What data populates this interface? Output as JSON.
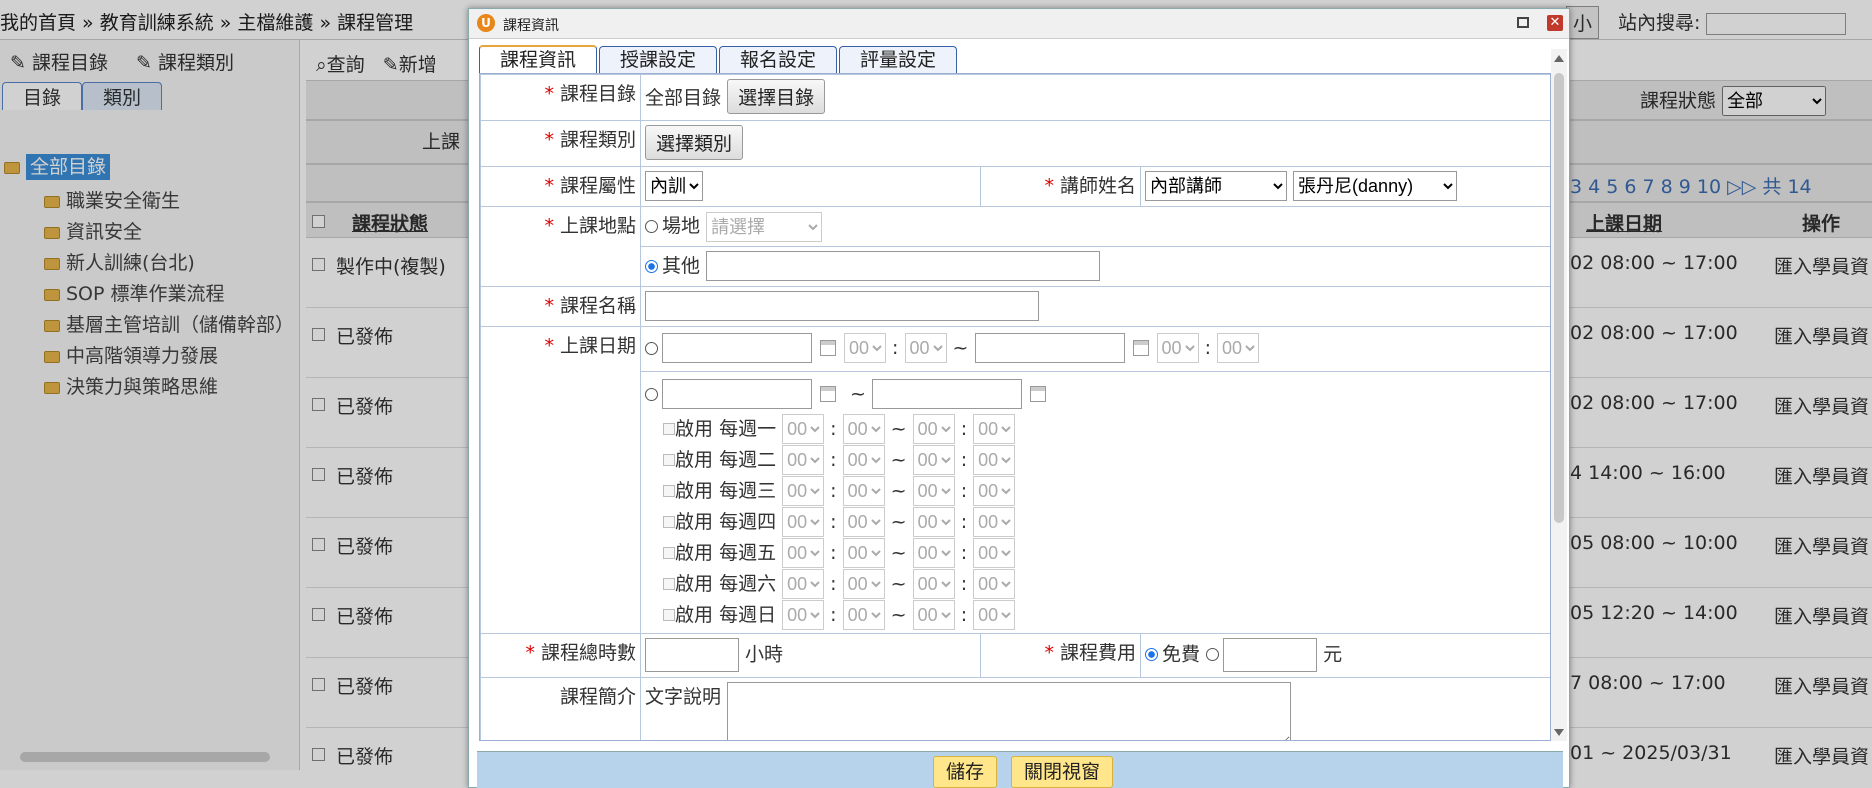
{
  "topbar": {
    "breadcrumb": "我的首頁 » 教育訓練系統 » 主檔維護 » 課程管理",
    "small_button": "小",
    "site_search_label": "站內搜尋:"
  },
  "left_panel": {
    "tab_catalog": "課程目錄",
    "tab_category": "課程類別",
    "subtab_catalog": "目錄",
    "subtab_category": "類別",
    "tree_root": "全部目錄",
    "tree_items": [
      "職業安全衛生",
      "資訊安全",
      "新人訓練(台北)",
      "SOP 標準作業流程",
      "基層主管培訓（儲備幹部）",
      "中高階領導力發展",
      "決策力與策略思維"
    ]
  },
  "right_panel": {
    "query_button": "查詢",
    "add_button": "新增",
    "status_label": "課程狀態",
    "status_value": "全部",
    "left_header_frag": "上課",
    "pager": "3 4 5 6 7 8 9 10",
    "pager_total": "共 14",
    "col_status": "課程狀態",
    "col_date": "上課日期",
    "col_action": "操作",
    "rows": [
      {
        "status": "製作中(複製)",
        "date": "02 08:00 ~ 17:00",
        "action": "匯入學員資"
      },
      {
        "status": "已發佈",
        "date": "02 08:00 ~ 17:00",
        "action": "匯入學員資"
      },
      {
        "status": "已發佈",
        "date": "02 08:00 ~ 17:00",
        "action": "匯入學員資"
      },
      {
        "status": "已發佈",
        "date": "4 14:00 ~ 16:00",
        "action": "匯入學員資"
      },
      {
        "status": "已發佈",
        "date": "05 08:00 ~ 10:00",
        "action": "匯入學員資"
      },
      {
        "status": "已發佈",
        "date": "05 12:20 ~ 14:00",
        "action": "匯入學員資"
      },
      {
        "status": "已發佈",
        "date": "7 08:00 ~ 17:00",
        "action": "匯入學員資"
      },
      {
        "status": "已發佈",
        "date": "01 ~ 2025/03/31",
        "action": "匯入學員資"
      }
    ]
  },
  "dialog": {
    "title": "課程資訊",
    "tabs": [
      "課程資訊",
      "授課設定",
      "報名設定",
      "評量設定"
    ],
    "labels": {
      "catalog": "課程目錄",
      "category": "課程類別",
      "attribute": "課程屬性",
      "instructor": "講師姓名",
      "location": "上課地點",
      "name": "課程名稱",
      "date": "上課日期",
      "hours": "課程總時數",
      "fee": "課程費用",
      "intro": "課程簡介"
    },
    "catalog_value": "全部目錄",
    "select_catalog_button": "選擇目錄",
    "select_category_button": "選擇類別",
    "attribute_value": "內訓",
    "instructor_type": "內部講師",
    "instructor_name": "張丹尼(danny)",
    "location_venue": "場地",
    "location_venue_placeholder": "請選擇",
    "location_other": "其他",
    "time_zero": "00",
    "tilde": "~",
    "colon": ":",
    "enable": "啟用",
    "weekdays": [
      "每週一",
      "每週二",
      "每週三",
      "每週四",
      "每週五",
      "每週六",
      "每週日"
    ],
    "hours_unit": "小時",
    "fee_free": "免費",
    "fee_unit": "元",
    "intro_text_label": "文字說明",
    "save_button": "儲存",
    "close_button": "關閉視窗"
  }
}
